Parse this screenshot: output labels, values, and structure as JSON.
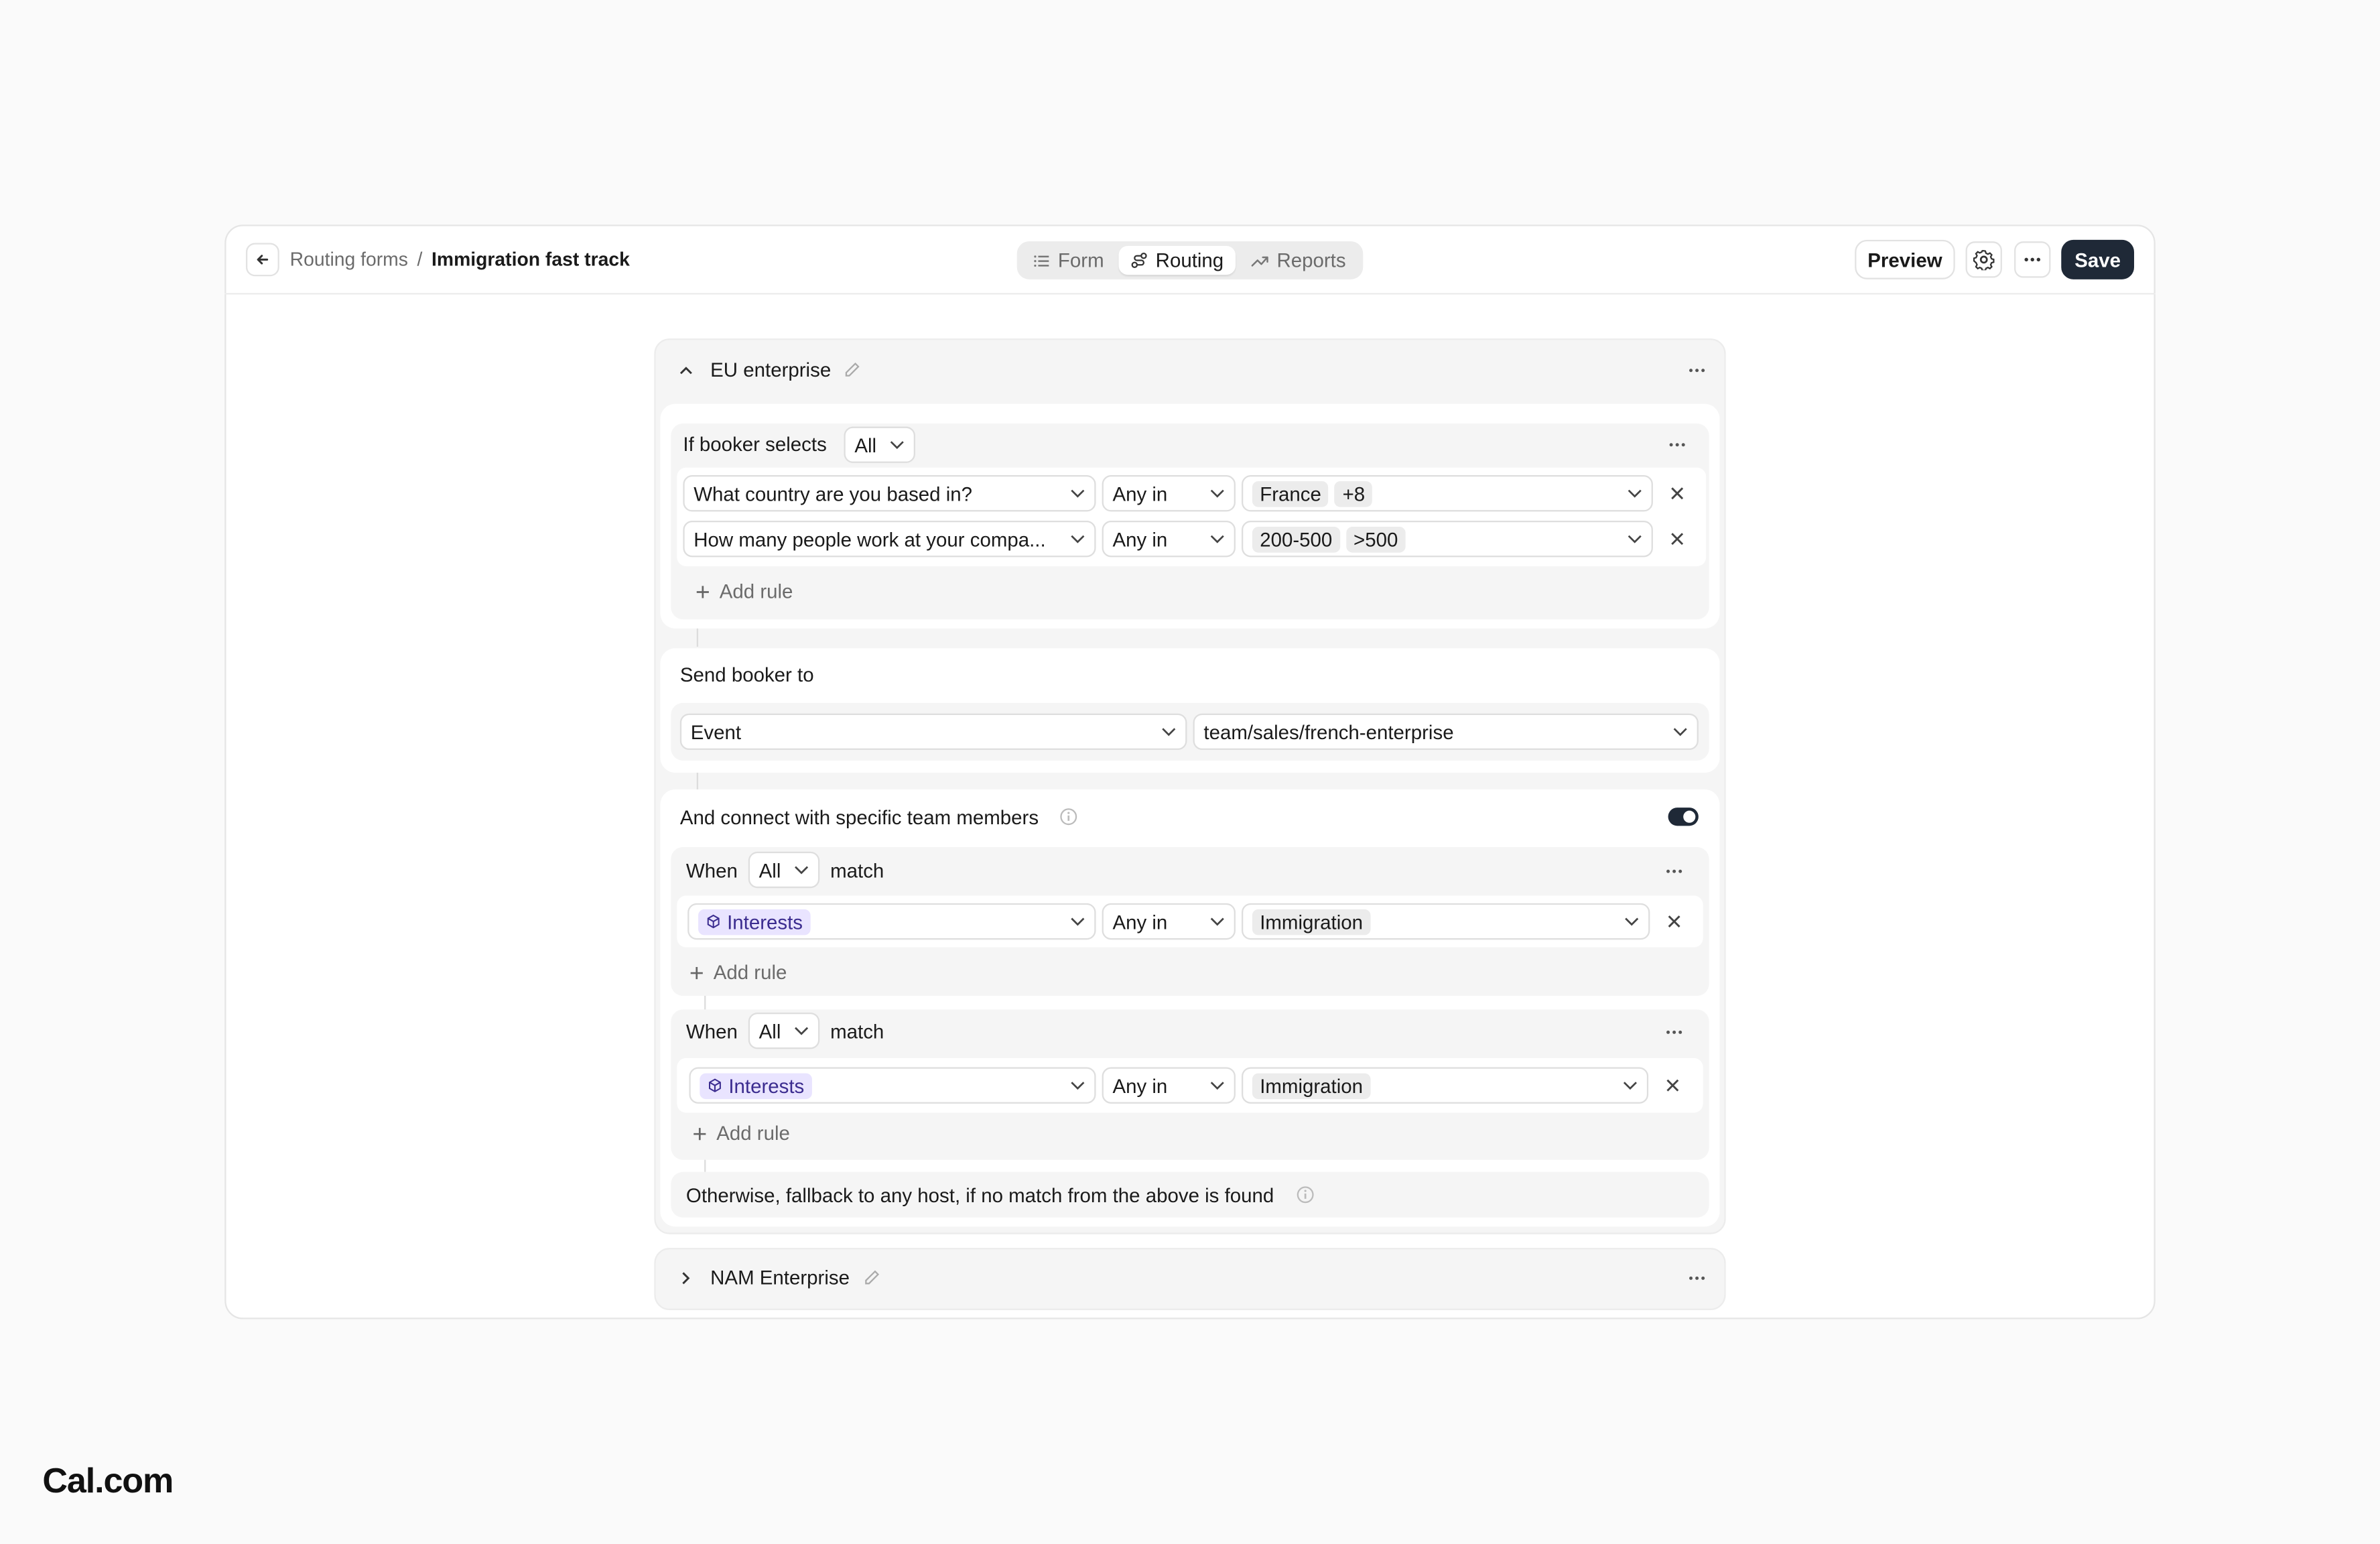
{
  "breadcrumb": {
    "parent": "Routing forms",
    "separator": "/",
    "current": "Immigration fast track"
  },
  "tabs": [
    {
      "label": "Form",
      "icon": "list-icon",
      "active": false
    },
    {
      "label": "Routing",
      "icon": "route-icon",
      "active": true
    },
    {
      "label": "Reports",
      "icon": "trending-icon",
      "active": false
    }
  ],
  "toolbar": {
    "preview_label": "Preview",
    "save_label": "Save"
  },
  "routes": [
    {
      "title": "EU enterprise",
      "expanded": true,
      "condition": {
        "prefix": "If booker selects",
        "mode": "All",
        "rules": [
          {
            "field": "What country are you based in?",
            "operator": "Any in",
            "values": [
              "France",
              "+8"
            ]
          },
          {
            "field": "How many people work at your compa...",
            "operator": "Any in",
            "values": [
              "200-500",
              ">500"
            ]
          }
        ],
        "add_rule": "Add rule"
      },
      "send": {
        "label": "Send booker to",
        "type": "Event",
        "target": "team/sales/french-enterprise"
      },
      "team": {
        "label": "And connect with specific team members",
        "toggle_on": true,
        "groups": [
          {
            "when": "When",
            "mode": "All",
            "match": "match",
            "rule": {
              "field": "Interests",
              "operator": "Any in",
              "value": "Immigration"
            },
            "add_rule": "Add rule"
          },
          {
            "when": "When",
            "mode": "All",
            "match": "match",
            "rule": {
              "field": "Interests",
              "operator": "Any in",
              "value": "Immigration"
            },
            "add_rule": "Add rule"
          }
        ],
        "fallback": "Otherwise, fallback to any host, if no match from the above is found"
      }
    },
    {
      "title": "NAM Enterprise",
      "expanded": false
    }
  ],
  "brand": {
    "logo_text": "Cal.com"
  },
  "colors": {
    "primary_dark": "#1f2937",
    "chip_purple_bg": "#e9e4ff",
    "chip_purple_text": "#3b2c8f",
    "page_bg": "#fafafa"
  }
}
